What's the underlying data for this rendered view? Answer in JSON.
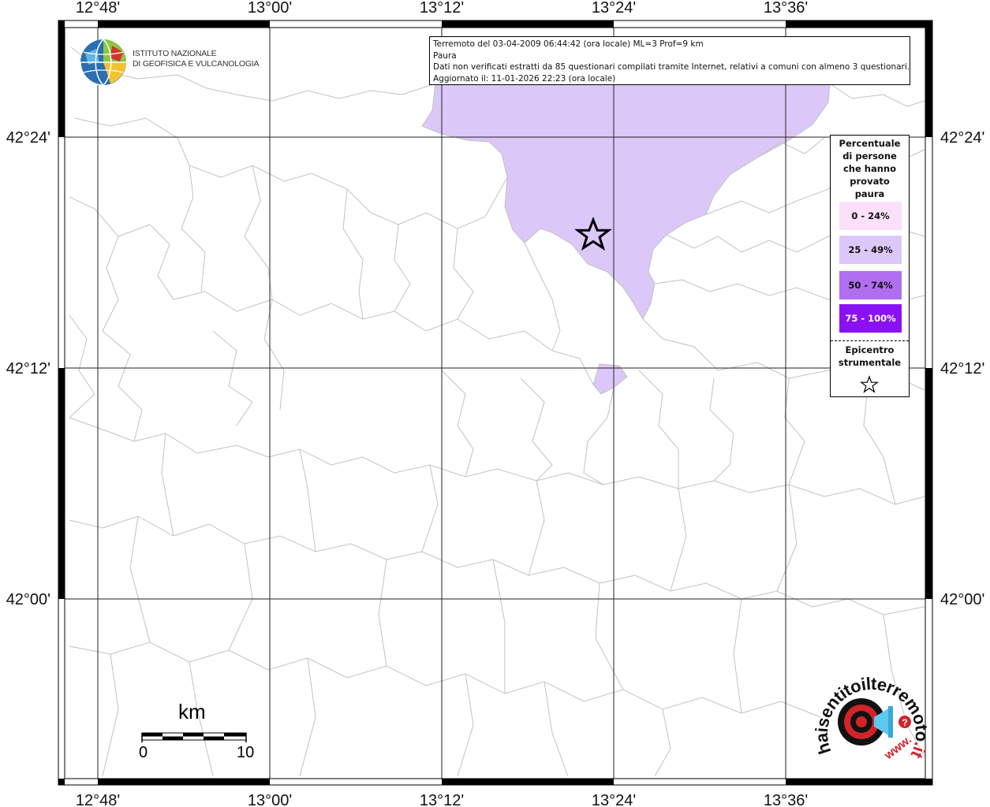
{
  "map": {
    "lon_ticks": [
      "12°48'",
      "13°00'",
      "13°12'",
      "13°24'",
      "13°36'"
    ],
    "lat_ticks": [
      "42°24'",
      "42°12'",
      "42°00'"
    ]
  },
  "info": {
    "line1": "Terremoto del 03-04-2009 06:44:42 (ora locale) ML=3 Prof=9 km",
    "line2": "Paura",
    "line3": "Dati non verificati estratti da 85 questionari compilati tramite Internet, relativi a comuni con almeno 3 questionari.",
    "line4": "Aggiornato il: 11-01-2026 22:23 (ora locale)"
  },
  "logo": {
    "line1": "Istituto Nazionale",
    "line2": "di Geofisica e Vulcanologia",
    "icon": "globe-logo-icon"
  },
  "legend": {
    "title": [
      "Percentuale",
      "di persone",
      "che hanno",
      "provato",
      "paura"
    ],
    "classes": [
      {
        "label": "0 - 24%",
        "color": "#fbe0fb",
        "text_color": "#111111"
      },
      {
        "label": "25 - 49%",
        "color": "#dcc8f8",
        "text_color": "#111111"
      },
      {
        "label": "50 - 74%",
        "color": "#b06ef0",
        "text_color": "#111111"
      },
      {
        "label": "75 - 100%",
        "color": "#8b11f5",
        "text_color": "#ffffff"
      }
    ],
    "epicenter_label": [
      "Epicentro",
      "strumentale"
    ],
    "epicenter_icon": "star-icon"
  },
  "scale": {
    "unit": "km",
    "start": "0",
    "end": "10"
  },
  "brand": {
    "text_main": "haisentitoilterremoto",
    "text_tld": ".it",
    "text_www": "www.",
    "icon": "megaphone-target-icon"
  },
  "colors": {
    "felt_area": "#dcc8f8",
    "boundary": "#c2c2c2",
    "frame": "#000000",
    "brand_red": "#d2232a"
  }
}
